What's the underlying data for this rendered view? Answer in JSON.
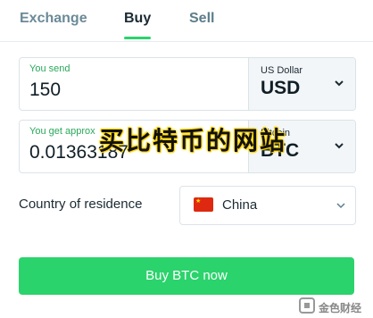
{
  "tabs": {
    "exchange": "Exchange",
    "buy": "Buy",
    "sell": "Sell"
  },
  "send": {
    "label": "You send",
    "amount": "150",
    "currency_label": "US Dollar",
    "currency_code": "USD"
  },
  "get": {
    "label": "You get approx",
    "amount": "0.01363187",
    "currency_label": "Bitcoin",
    "currency_code": "BTC"
  },
  "country": {
    "label": "Country of residence",
    "value": "China"
  },
  "buy_button": "Buy BTC now",
  "overlay": {
    "watermark": "买比特币的网站",
    "logo_text": "金色财经"
  },
  "colors": {
    "accent": "#2bd36c",
    "send_label": "#2aa85b",
    "watermark_glow": "#ffd400",
    "flag": "#de2910"
  },
  "icons": {
    "currency_dropdown": "chevron-down-icon",
    "country_dropdown": "chevron-down-icon",
    "country_flag": "china-flag-icon",
    "logo": "jinse-logo-icon"
  }
}
